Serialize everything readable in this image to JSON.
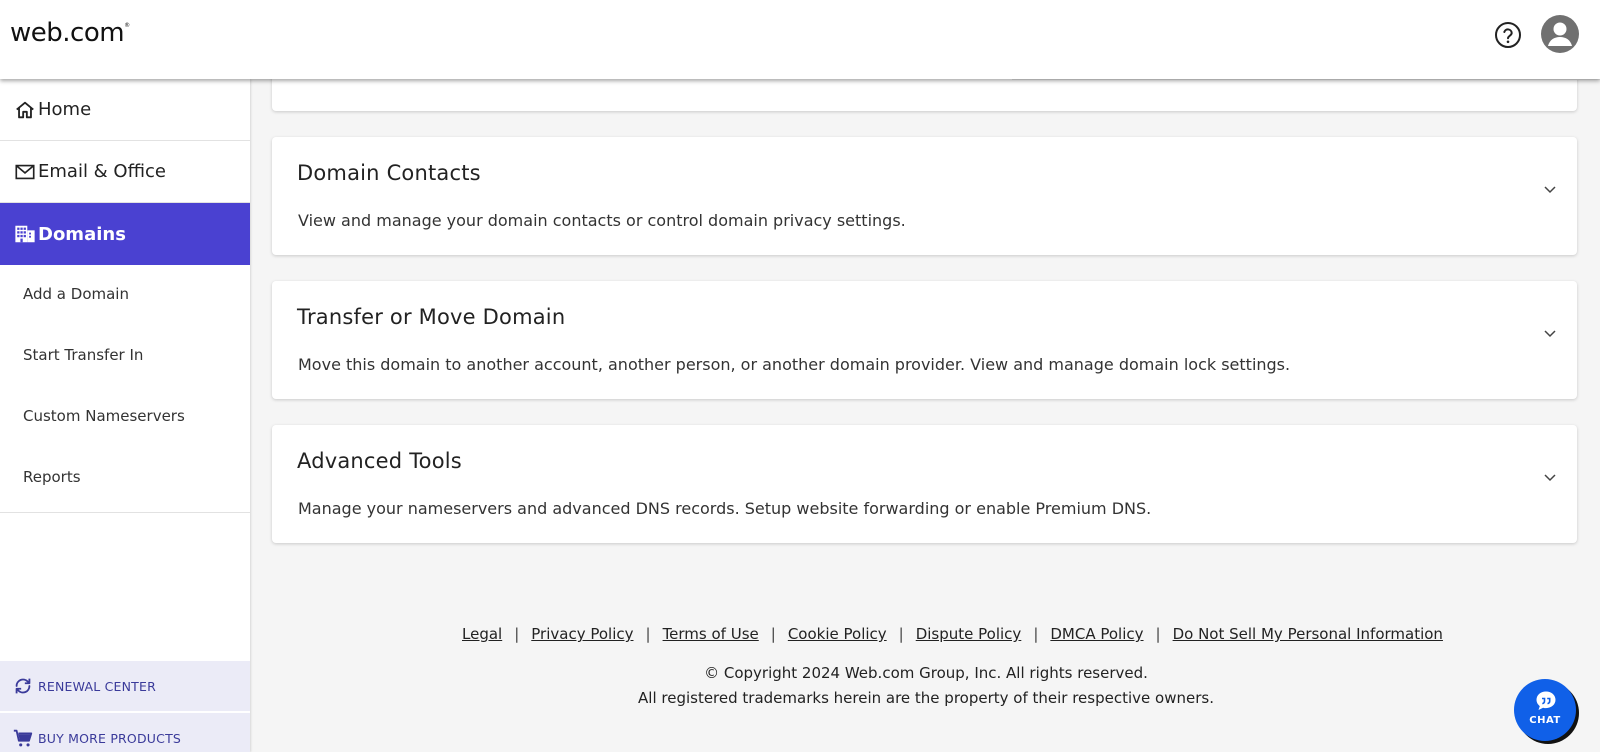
{
  "header": {
    "logo_text": "web.com",
    "logo_mark": "®",
    "help_icon": "question-circle-icon",
    "avatar_icon": "user-avatar-icon"
  },
  "sidebar": {
    "items": [
      {
        "label": "Home",
        "icon": "home-icon"
      },
      {
        "label": "Email & Office",
        "icon": "mail-icon"
      },
      {
        "label": "Domains",
        "icon": "building-icon",
        "active": true
      }
    ],
    "sub_items": [
      {
        "label": "Add a Domain"
      },
      {
        "label": "Start Transfer In"
      },
      {
        "label": "Custom Nameservers"
      },
      {
        "label": "Reports"
      }
    ],
    "bottom_links": [
      {
        "label": "RENEWAL CENTER",
        "icon": "refresh-icon"
      },
      {
        "label": "BUY MORE PRODUCTS",
        "icon": "cart-icon"
      }
    ],
    "active_color": "#4a41d1"
  },
  "main": {
    "cards": [
      {
        "title": "Domain Contacts",
        "description": "View and manage your domain contacts or control domain privacy settings."
      },
      {
        "title": "Transfer or Move Domain",
        "description": "Move this domain to another account, another person, or another domain provider. View and manage domain lock settings."
      },
      {
        "title": "Advanced Tools",
        "description": "Manage your nameservers and advanced DNS records. Setup website forwarding or enable Premium DNS."
      }
    ]
  },
  "footer": {
    "links": [
      "Legal",
      "Privacy Policy",
      "Terms of Use",
      "Cookie Policy",
      "Dispute Policy",
      "DMCA Policy",
      "Do Not Sell My Personal Information"
    ],
    "separator": "|",
    "copyright": "© Copyright 2024 Web.com Group, Inc. All rights reserved.",
    "trademark": "All registered trademarks herein are the property of their respective owners."
  },
  "chat": {
    "label": "CHAT",
    "color": "#1060e8"
  }
}
